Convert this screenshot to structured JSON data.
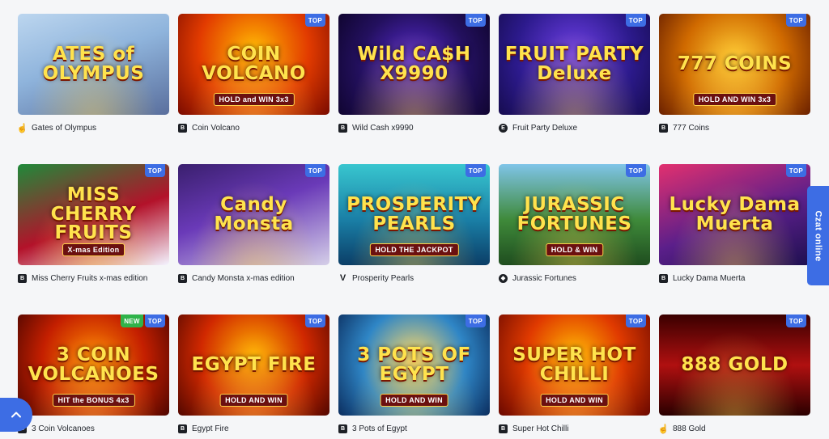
{
  "accent_color": "#3d6de4",
  "new_color": "#2fb34a",
  "chat": {
    "label": "Czat online"
  },
  "scroll_top": {
    "icon": "chevron-up-icon"
  },
  "games": [
    {
      "name": "Gates of Olympus",
      "art_title": "ATES of OLYMPUS",
      "art_sub": "",
      "provider_icon": "hand-icon",
      "badges": [],
      "bg": "linear-gradient(160deg,#bcd6ef 0%,#8fb4dc 45%,#5a6f9d 100%)"
    },
    {
      "name": "Coin Volcano",
      "art_title": "COIN VOLCANO",
      "art_sub": "HOLD and WIN 3x3",
      "provider_icon": "b-icon",
      "badges": [
        "TOP"
      ],
      "bg": "radial-gradient(circle at 50% 35%,#ffb400 0%,#e23b00 55%,#7a0b00 100%)"
    },
    {
      "name": "Wild Cash x9990",
      "art_title": "Wild CA$H X9990",
      "art_sub": "",
      "provider_icon": "b-icon",
      "badges": [
        "TOP"
      ],
      "bg": "radial-gradient(circle at 50% 50%,#5a2bd6 0%,#23105e 60%,#100530 100%)"
    },
    {
      "name": "Fruit Party Deluxe",
      "art_title": "FRUIT PARTY Deluxe",
      "art_sub": "",
      "provider_icon": "e-icon",
      "badges": [
        "TOP"
      ],
      "bg": "radial-gradient(circle at 50% 40%,#6e3fe6 0%,#2c1a8c 60%,#160c4f 100%)"
    },
    {
      "name": "777 Coins",
      "art_title": "777 COINS",
      "art_sub": "HOLD AND WIN 3x3",
      "provider_icon": "b-icon",
      "badges": [
        "TOP"
      ],
      "bg": "radial-gradient(circle at 50% 45%,#ffcc33 0%,#d06a00 55%,#6a2000 100%)"
    },
    {
      "name": "Miss Cherry Fruits x-mas edition",
      "art_title": "MISS CHERRY FRUITS",
      "art_sub": "X-mas Edition",
      "provider_icon": "b-icon",
      "badges": [
        "TOP"
      ],
      "bg": "linear-gradient(160deg,#1f8a3a 0%,#b3122a 55%,#f4f4ff 100%)"
    },
    {
      "name": "Candy Monsta x-mas edition",
      "art_title": "Candy Monsta",
      "art_sub": "",
      "provider_icon": "b-icon",
      "badges": [
        "TOP"
      ],
      "bg": "linear-gradient(160deg,#3a1f6e 0%,#6a3ab8 45%,#d5cfe8 100%)"
    },
    {
      "name": "Prosperity Pearls",
      "art_title": "PROSPERITY PEARLS",
      "art_sub": "HOLD THE JACKPOT",
      "provider_icon": "v-icon",
      "badges": [
        "TOP"
      ],
      "bg": "linear-gradient(180deg,#38c6cf 0%,#1a7fa6 55%,#0b3e67 100%)"
    },
    {
      "name": "Jurassic Fortunes",
      "art_title": "JURASSIC FORTUNES",
      "art_sub": "HOLD & WIN",
      "provider_icon": "shield-icon",
      "badges": [
        "TOP"
      ],
      "bg": "linear-gradient(180deg,#7fc4e8 0%,#3f8a3a 55%,#1f4d1f 100%)"
    },
    {
      "name": "Lucky Dama Muerta",
      "art_title": "Lucky Dama Muerta",
      "art_sub": "",
      "provider_icon": "b-icon",
      "badges": [
        "TOP"
      ],
      "bg": "linear-gradient(160deg,#e2306f 0%,#5b1f8a 55%,#1e1050 100%)"
    },
    {
      "name": "3 Coin Volcanoes",
      "art_title": "3 COIN VOLCANOES",
      "art_sub": "HIT the BONUS 4x3",
      "provider_icon": "b-icon",
      "badges": [
        "NEW",
        "TOP"
      ],
      "bg": "radial-gradient(circle at 50% 45%,#ff8a00 0%,#c41f00 55%,#4e0600 100%)"
    },
    {
      "name": "Egypt Fire",
      "art_title": "EGYPT FIRE",
      "art_sub": "HOLD AND WIN",
      "provider_icon": "b-icon",
      "badges": [
        "TOP"
      ],
      "bg": "radial-gradient(circle at 50% 40%,#ffb000 0%,#d02800 55%,#520700 100%)"
    },
    {
      "name": "3 Pots of Egypt",
      "art_title": "3 POTS OF EGYPT",
      "art_sub": "HOLD AND WIN",
      "provider_icon": "b-icon",
      "badges": [
        "TOP"
      ],
      "bg": "radial-gradient(circle at 50% 45%,#ffd966 0%,#2f86c6 55%,#0b2d5e 100%)"
    },
    {
      "name": "Super Hot Chilli",
      "art_title": "SUPER HOT CHILLI",
      "art_sub": "HOLD AND WIN",
      "provider_icon": "b-icon",
      "badges": [
        "TOP"
      ],
      "bg": "radial-gradient(circle at 50% 40%,#ffb300 0%,#e03a00 50%,#6a0800 100%)"
    },
    {
      "name": "888 Gold",
      "art_title": "888 GOLD",
      "art_sub": "",
      "provider_icon": "hand-icon",
      "badges": [
        "TOP"
      ],
      "bg": "linear-gradient(180deg,#3a0000 0%,#b01010 50%,#2a0000 100%)"
    }
  ]
}
